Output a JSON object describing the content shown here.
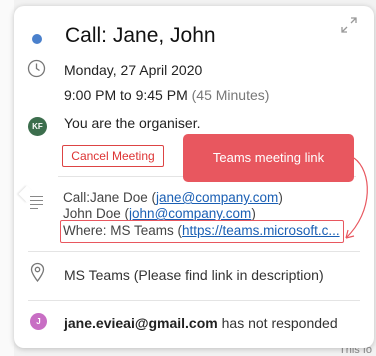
{
  "event": {
    "title": "Call: Jane, John",
    "date": "Monday, 27 April 2020",
    "time_range": "9:00 PM to 9:45 PM",
    "duration": "(45 Minutes)",
    "organiser_text": "You are the organiser.",
    "organiser_initials": "KF",
    "cancel_label": "Cancel Meeting",
    "location": "MS Teams (Please find link in description)"
  },
  "annotation": {
    "callout_text": "Teams meeting link",
    "color": "#e8575f"
  },
  "description": {
    "line1_prefix": "Call:Jane Doe (",
    "line1_email": "jane@company.com",
    "line1_suffix": ")",
    "line2_prefix": "John Doe (",
    "line2_email": "john@company.com",
    "line2_suffix": ")",
    "line3_prefix": "Where: MS Teams (",
    "line3_link": "https://teams.microsoft.c..."
  },
  "attendee": {
    "initial": "J",
    "email": "jane.evieai@gmail.com",
    "status": " has not responded"
  },
  "background": {
    "partial_text": "This fo"
  },
  "icons": {
    "expand": "expand-icon",
    "calendar_dot": "calendar-color-dot",
    "clock": "clock-icon",
    "description": "description-icon",
    "location": "location-pin-icon"
  },
  "colors": {
    "calendar_dot": "#4a80cc",
    "organiser_avatar": "#3c6e4d",
    "attendee_avatar": "#c86ec4",
    "link": "#1a5fb4",
    "cancel": "#d33"
  }
}
